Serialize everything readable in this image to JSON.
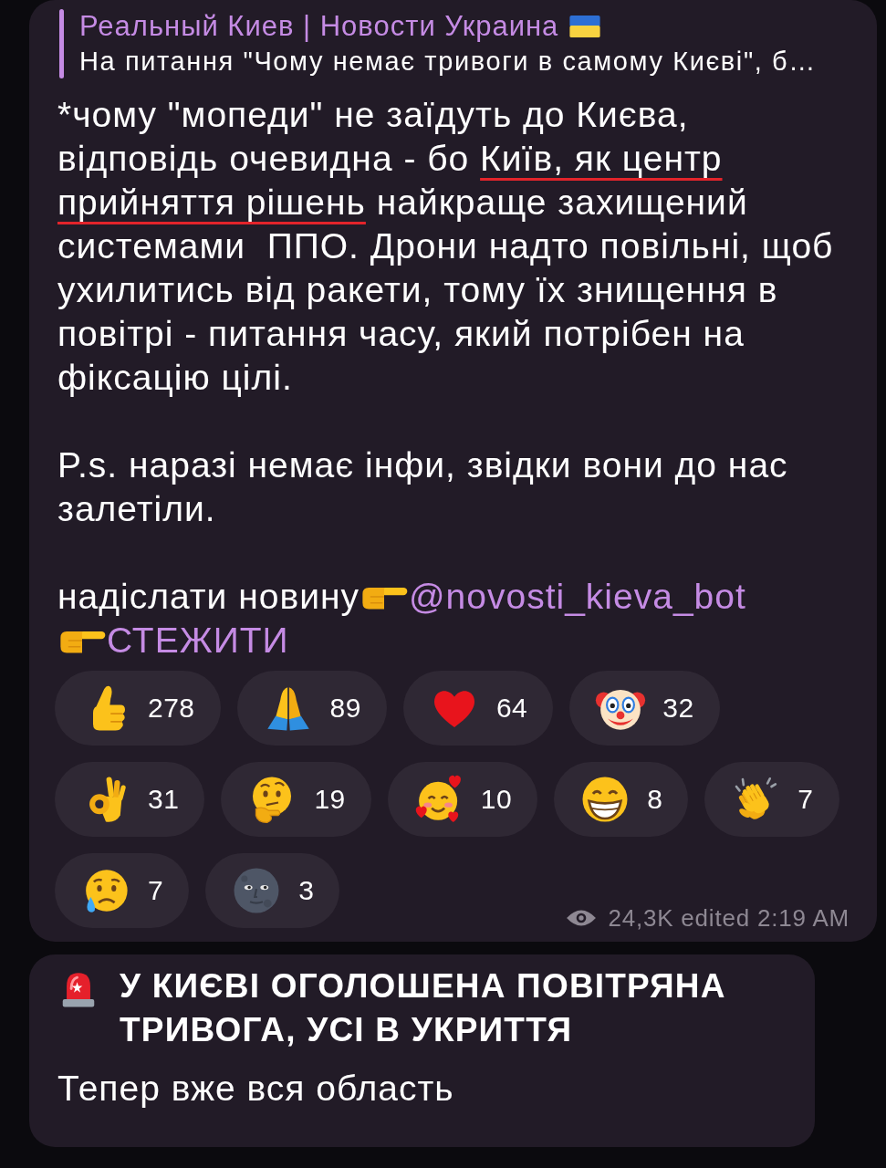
{
  "reply": {
    "author": "Реальный Киев | Новости Украина",
    "text": "На питання \"Чому немає тривоги в самому Києві\", б…"
  },
  "message": {
    "paragraphs": [
      {
        "segments": [
          {
            "text": "*чому \"мопеди\" не заїдуть до Києва,\nвідповідь очевидна - бо ",
            "underlined": false
          },
          {
            "text": "Київ, як центр\nприйняття рішень",
            "underlined": true
          },
          {
            "text": " найкраще захищений\nсистемами  ППО. Дрони надто повільні, щоб\nухилитись від ракети, тому їх знищення в\nповітрі - питання часу, який потрібен на\nфіксацію цілі.",
            "underlined": false
          }
        ]
      },
      {
        "segments": [
          {
            "text": "P.s. наразі немає інфи, звідки вони до нас\nзалетіли.",
            "underlined": false
          }
        ]
      }
    ],
    "links": {
      "text": "надіслати новину",
      "mention": "@novosti_kieva_bot",
      "follow": "СТЕЖИТИ"
    },
    "reactions": [
      {
        "kind": "thumbs_up",
        "count": "278"
      },
      {
        "kind": "folded_hands",
        "count": "89"
      },
      {
        "kind": "heart",
        "count": "64"
      },
      {
        "kind": "clown_face",
        "count": "32"
      },
      {
        "kind": "ok_hand",
        "count": "31"
      },
      {
        "kind": "thinking_face",
        "count": "19"
      },
      {
        "kind": "smiling_face_hearts",
        "count": "10"
      },
      {
        "kind": "grinning_face",
        "count": "8"
      },
      {
        "kind": "clapping_hands",
        "count": "7"
      },
      {
        "kind": "crying_face",
        "count": "7"
      },
      {
        "kind": "moon_face",
        "count": "3"
      }
    ],
    "views": "24,3K",
    "time": "edited 2:19 AM"
  },
  "next_message": {
    "title": "У КИЄВІ ОГОЛОШЕНА ПОВІТРЯНА ТРИВОГА, УСІ В УКРИТТЯ",
    "text": "Тепер вже вся область"
  }
}
